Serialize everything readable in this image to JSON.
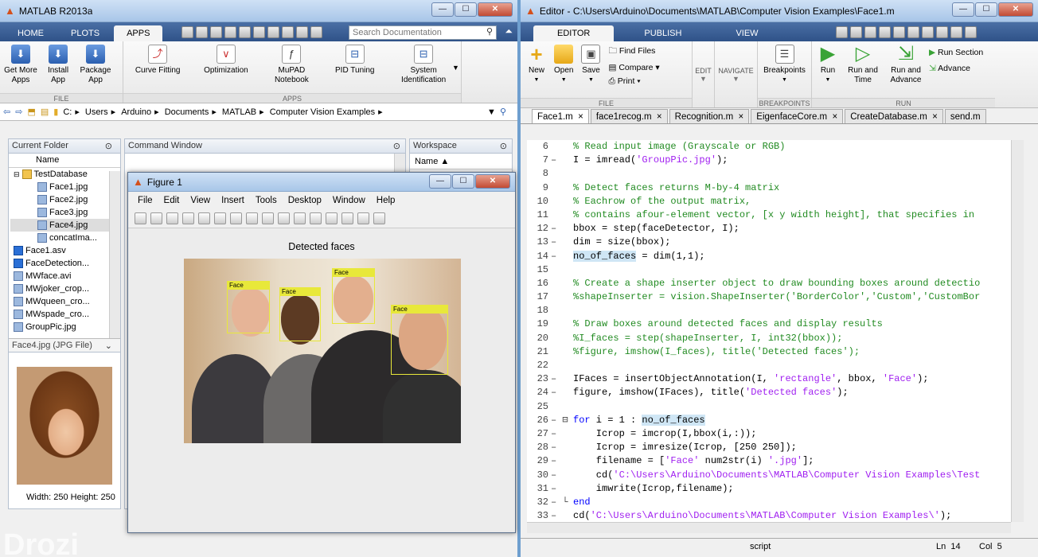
{
  "main": {
    "title": "MATLAB R2013a",
    "tabs": [
      "HOME",
      "PLOTS",
      "APPS"
    ],
    "search_placeholder": "Search Documentation",
    "ribbon": {
      "file_group": {
        "label": "FILE",
        "buttons": [
          "Get More Apps",
          "Install App",
          "Package App"
        ]
      },
      "apps_group": {
        "label": "APPS",
        "buttons": [
          "Curve Fitting",
          "Optimization",
          "MuPAD Notebook",
          "PID Tuning",
          "System Identification"
        ]
      }
    },
    "address": [
      "C:",
      "Users",
      "Arduino",
      "Documents",
      "MATLAB",
      "Computer Vision Examples"
    ],
    "current_folder": {
      "title": "Current Folder",
      "column": "Name",
      "items": [
        {
          "name": "TestDatabase",
          "type": "folder",
          "indent": 0
        },
        {
          "name": "Face1.jpg",
          "type": "img",
          "indent": 1
        },
        {
          "name": "Face2.jpg",
          "type": "img",
          "indent": 1
        },
        {
          "name": "Face3.jpg",
          "type": "img",
          "indent": 1
        },
        {
          "name": "Face4.jpg",
          "type": "img",
          "indent": 1,
          "selected": true
        },
        {
          "name": "concatIma...",
          "type": "img",
          "indent": 1
        },
        {
          "name": "Face1.asv",
          "type": "m",
          "indent": 0
        },
        {
          "name": "FaceDetection...",
          "type": "m",
          "indent": 0
        },
        {
          "name": "MWface.avi",
          "type": "img",
          "indent": 0
        },
        {
          "name": "MWjoker_crop...",
          "type": "img",
          "indent": 0
        },
        {
          "name": "MWqueen_cro...",
          "type": "img",
          "indent": 0
        },
        {
          "name": "MWspade_cro...",
          "type": "img",
          "indent": 0
        },
        {
          "name": "GroupPic.jpg",
          "type": "img",
          "indent": 0
        }
      ],
      "details_title": "Face4.jpg (JPG File)",
      "details_size": "Width: 250  Height: 250"
    },
    "command_window": {
      "title": "Command Window"
    },
    "workspace": {
      "title": "Workspace",
      "column": "Name ▲"
    }
  },
  "figure": {
    "title": "Figure 1",
    "menu": [
      "File",
      "Edit",
      "View",
      "Insert",
      "Tools",
      "Desktop",
      "Window",
      "Help"
    ],
    "plot_title": "Detected faces",
    "face_label": "Face"
  },
  "editor": {
    "title": "Editor - C:\\Users\\Arduino\\Documents\\MATLAB\\Computer Vision Examples\\Face1.m",
    "tabs": [
      "EDITOR",
      "PUBLISH",
      "VIEW"
    ],
    "ribbon": {
      "new": "New",
      "open": "Open",
      "save": "Save",
      "find_files": "Find Files",
      "compare": "Compare",
      "print": "Print",
      "edit": "EDIT",
      "navigate": "NAVIGATE",
      "breakpoints": "Breakpoints",
      "run": "Run",
      "run_and_time": "Run and Time",
      "run_and_advance": "Run and Advance",
      "run_section": "Run Section",
      "advance": "Advance",
      "groups": [
        "FILE",
        "BREAKPOINTS",
        "RUN"
      ]
    },
    "file_tabs": [
      "Face1.m",
      "face1recog.m",
      "Recognition.m",
      "EigenfaceCore.m",
      "CreateDatabase.m",
      "send.m"
    ],
    "status": {
      "type": "script",
      "ln": "Ln  14",
      "col": "Col  5"
    }
  },
  "watermark": "Drozi"
}
